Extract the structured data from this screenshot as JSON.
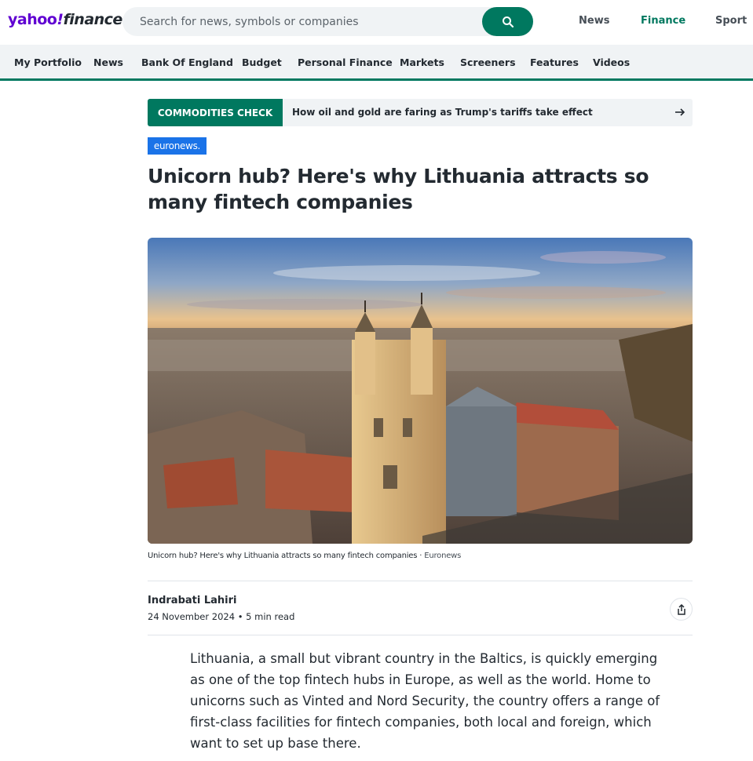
{
  "header": {
    "logo_yahoo": "yahoo",
    "logo_bang": "!",
    "logo_finance": "finance",
    "search_placeholder": "Search for news, symbols or companies",
    "links": [
      "News",
      "Finance",
      "Sport"
    ],
    "active_link": "Finance",
    "accent_color": "#00785f",
    "brand_color": "#6001d2"
  },
  "nav": {
    "items": [
      "My Portfolio",
      "News",
      "Bank Of England",
      "Budget",
      "Personal Finance",
      "Markets",
      "Screeners",
      "Features",
      "Videos"
    ]
  },
  "banner": {
    "tag": "COMMODITIES CHECK",
    "headline": "How oil and gold are faring as Trump's tariffs take effect"
  },
  "article": {
    "provider": "euronews.",
    "title": "Unicorn hub? Here's why Lithuania attracts so many fintech companies",
    "caption": "Unicorn hub? Here's why Lithuania attracts so many fintech companies",
    "caption_separator": "·",
    "caption_source": "Euronews",
    "author": "Indrabati Lahiri",
    "date": "24 November 2024",
    "meta_separator": "•",
    "read_time": "5 min read",
    "body": "Lithuania, a small but vibrant country in the Baltics, is quickly emerging as one of the top fintech hubs in Europe, as well as the world. Home to unicorns such as Vinted and Nord Security, the country offers a range of first-class facilities for fintech companies, both local and foreign, which want to set up base there."
  },
  "icons": {
    "search": "search-icon",
    "arrow": "arrow-right-icon",
    "share": "share-icon"
  }
}
